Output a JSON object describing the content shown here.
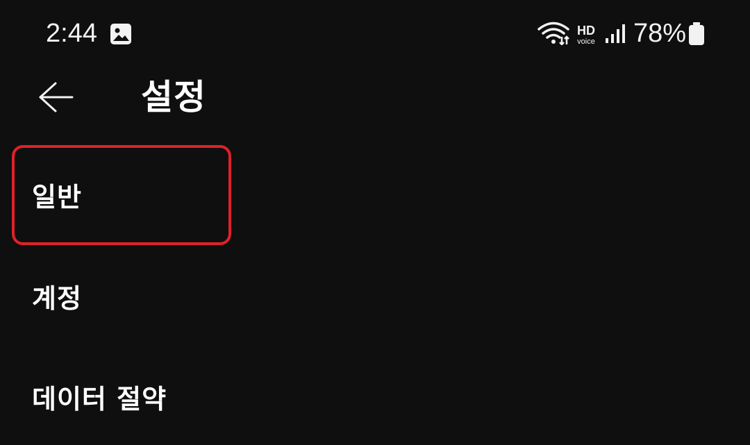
{
  "status_bar": {
    "time": "2:44",
    "battery_percent": "78%",
    "hd_text": "HD",
    "voice_text": "voice",
    "icons": [
      "gallery-icon",
      "wifi-icon",
      "hd-voice-icon",
      "signal-icon",
      "battery-icon"
    ]
  },
  "header": {
    "title": "설정",
    "back_icon": "arrow-left-icon"
  },
  "menu": {
    "items": [
      {
        "label": "일반",
        "highlighted": true
      },
      {
        "label": "계정",
        "highlighted": false
      },
      {
        "label": "데이터 절약",
        "highlighted": false
      }
    ]
  },
  "colors": {
    "background": "#0f0f0f",
    "text": "#ffffff",
    "highlight": "#e2202a"
  }
}
